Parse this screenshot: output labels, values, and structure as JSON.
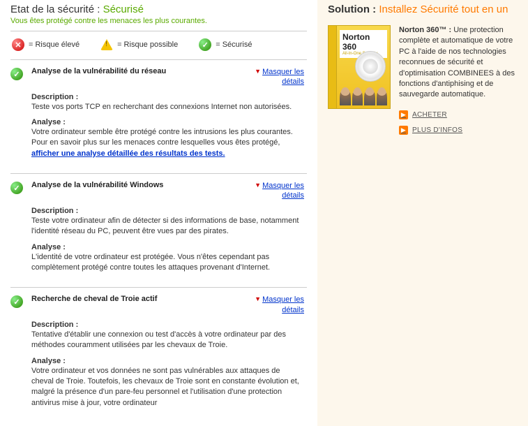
{
  "header": {
    "title_label": "Etat de la sécurité : ",
    "title_value": "Sécurisé",
    "subtitle": "Vous êtes protégé contre les menaces les plus courantes."
  },
  "legend": {
    "high": "= Risque élevé",
    "possible": "= Risque possible",
    "secure": "= Sécurisé"
  },
  "toggle": {
    "label_line1": "Masquer les",
    "label_line2": "détails"
  },
  "labels": {
    "description": "Description :",
    "analysis": "Analyse :"
  },
  "sections": [
    {
      "title": "Analyse de la vulnérabilité du réseau",
      "description": "Teste vos ports TCP en recherchant des connexions Internet non autorisées.",
      "analysis": "Votre ordinateur semble être protégé contre les intrusions les plus courantes. Pour en savoir plus sur les menaces contre lesquelles vous êtes protégé, ",
      "link": "afficher une analyse détaillée des résultats des tests."
    },
    {
      "title": "Analyse de la vulnérabilité Windows",
      "description": "Teste votre ordinateur afin de détecter si des informations de base, notamment l'identité réseau du PC, peuvent être vues par des pirates.",
      "analysis": "L'identité de votre ordinateur est protégée. Vous n'êtes cependant pas complètement protégé contre toutes les attaques provenant d'Internet."
    },
    {
      "title": "Recherche de cheval de Troie actif",
      "description": "Tentative d'établir une connexion ou test d'accès à votre ordinateur par des méthodes couramment utilisées par les chevaux de Troie.",
      "analysis": "Votre ordinateur et vos données ne sont pas vulnérables aux attaques de cheval de Troie. Toutefois, les chevaux de Troie sont en constante évolution et, malgré la présence d'un pare-feu personnel et l'utilisation d'une protection antivirus mise à jour, votre ordinateur"
    }
  ],
  "solution": {
    "title_label": "Solution : ",
    "title_value": "Installez Sécurité tout en un",
    "product_name": "Norton 360",
    "product_tag": "All-In-One Security",
    "desc_bold": "Norton 360™ : ",
    "desc": "Une protection complète et automatique de votre PC à l'aide de nos technologies reconnues de sécurité et d'optimisation COMBINEES à des fonctions d'antiphising et de sauvegarde automatique.",
    "actions": {
      "buy": "ACHETER",
      "more": "PLUS D'INFOS"
    }
  }
}
